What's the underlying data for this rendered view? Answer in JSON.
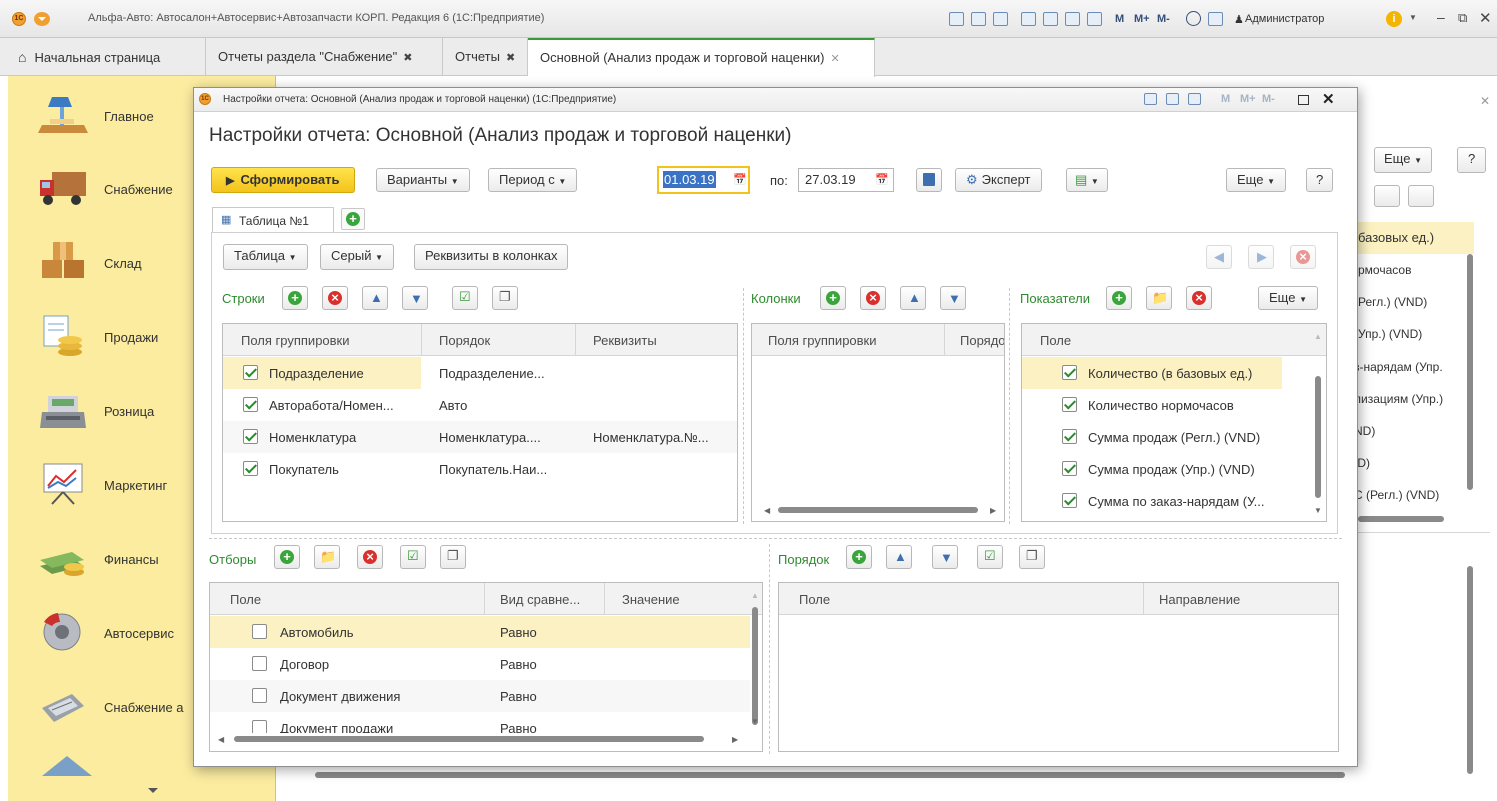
{
  "titlebar": {
    "title": "Альфа-Авто: Автосалон+Автосервис+Автозапчасти КОРП. Редакция 6 (1С:Предприятие)",
    "user": "Администратор",
    "m_labels": [
      "M",
      "M+",
      "M-"
    ]
  },
  "tabs": [
    {
      "label": "Начальная страница"
    },
    {
      "label": "Отчеты раздела \"Снабжение\""
    },
    {
      "label": "Отчеты"
    },
    {
      "label": "Основной (Анализ продаж и торговой наценки)"
    }
  ],
  "sidebar": {
    "items": [
      {
        "label": "Главное",
        "icon": "desk-lamp-icon"
      },
      {
        "label": "Снабжение",
        "icon": "truck-icon"
      },
      {
        "label": "Склад",
        "icon": "boxes-icon"
      },
      {
        "label": "Продажи",
        "icon": "coins-document-icon"
      },
      {
        "label": "Розница",
        "icon": "cash-register-icon"
      },
      {
        "label": "Маркетинг",
        "icon": "chart-board-icon"
      },
      {
        "label": "Финансы",
        "icon": "money-stack-icon"
      },
      {
        "label": "Автосервис",
        "icon": "brake-disc-icon"
      },
      {
        "label": "Снабжение а",
        "icon": "calculator-icon"
      }
    ]
  },
  "rightpanel": {
    "more_label": "Еще",
    "help_label": "?",
    "items": [
      "базовых ед.)",
      "рмочасов",
      "(Регл.) (VND)",
      "(Упр.) (VND)",
      "з-нарядам (Упр.",
      "лизациям (Упр.)",
      "ND)",
      "ID)",
      "С (Регл.) (VND)"
    ]
  },
  "dialog": {
    "window_title": "Настройки отчета: Основной (Анализ продаж и торговой наценки)  (1С:Предприятие)",
    "heading": "Настройки отчета: Основной (Анализ продаж и торговой наценки)",
    "toolbar": {
      "generate": "Сформировать",
      "variants": "Варианты",
      "period": "Период с",
      "date_from": "01.03.19",
      "to_label": "по:",
      "date_to": "27.03.19",
      "expert": "Эксперт",
      "more": "Еще",
      "help": "?"
    },
    "table_tab": "Таблица №1",
    "sub_toolbar": {
      "table": "Таблица",
      "gray": "Серый",
      "props_in_cols": "Реквизиты в колонках"
    },
    "rows_section": {
      "title": "Строки",
      "headers": [
        "Поля группировки",
        "Порядок",
        "Реквизиты"
      ],
      "rows": [
        {
          "checked": true,
          "field": "Подразделение",
          "order": "Подразделение...",
          "props": ""
        },
        {
          "checked": true,
          "field": "Авторабота/Номен...",
          "order": "Авто",
          "props": ""
        },
        {
          "checked": true,
          "field": "Номенклатура",
          "order": "Номенклатура....",
          "props": "Номенклатура.№..."
        },
        {
          "checked": true,
          "field": "Покупатель",
          "order": "Покупатель.Наи...",
          "props": ""
        }
      ]
    },
    "columns_section": {
      "title": "Колонки",
      "headers": [
        "Поля группировки",
        "Порядо"
      ]
    },
    "indicators_section": {
      "title": "Показатели",
      "more": "Еще",
      "headers": [
        "Поле"
      ],
      "rows": [
        {
          "checked": true,
          "label": "Количество (в базовых ед.)"
        },
        {
          "checked": true,
          "label": "Количество нормочасов"
        },
        {
          "checked": true,
          "label": "Сумма продаж (Регл.) (VND)"
        },
        {
          "checked": true,
          "label": "Сумма продаж (Упр.) (VND)"
        },
        {
          "checked": true,
          "label": "Сумма по заказ-нарядам (У..."
        }
      ]
    },
    "filters_section": {
      "title": "Отборы",
      "headers": [
        "Поле",
        "Вид сравне...",
        "Значение"
      ],
      "rows": [
        {
          "checked": false,
          "field": "Автомобиль",
          "comparison": "Равно",
          "value": ""
        },
        {
          "checked": false,
          "field": "Договор",
          "comparison": "Равно",
          "value": ""
        },
        {
          "checked": false,
          "field": "Документ движения",
          "comparison": "Равно",
          "value": ""
        },
        {
          "checked": false,
          "field": "Документ продажи",
          "comparison": "Равно",
          "value": ""
        }
      ]
    },
    "order_section": {
      "title": "Порядок",
      "headers": [
        "Поле",
        "Направление"
      ]
    }
  },
  "colors": {
    "accent_green": "#3aa53a",
    "sidebar_bg": "#fbeca0",
    "primary_button": "#f3c31a",
    "selection": "#fbf1c2"
  }
}
